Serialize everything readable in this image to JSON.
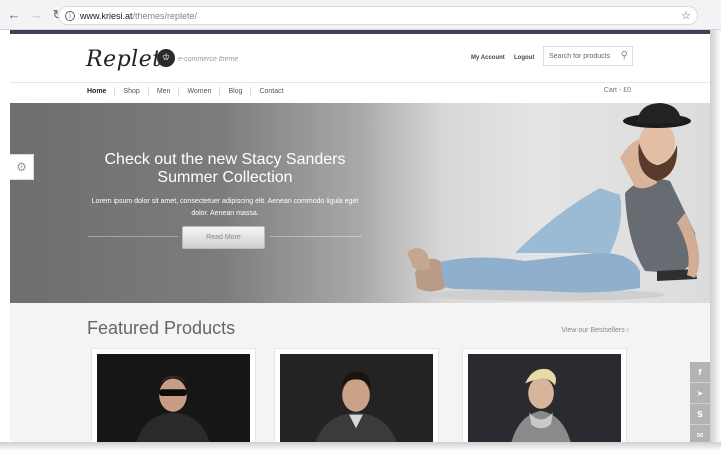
{
  "browser": {
    "url_host": "www.kriesi.at",
    "url_path": "/themes/replete/",
    "icons": [
      "back-arrow-icon",
      "forward-arrow-icon",
      "reload-icon",
      "info-icon",
      "bookmark-star-icon"
    ]
  },
  "header": {
    "logo": "Replete",
    "tagline": "e-commerce theme",
    "my_account": "My Account",
    "logout": "Logout",
    "search_placeholder": "Search for products"
  },
  "nav": {
    "items": [
      {
        "label": "Home",
        "active": true
      },
      {
        "label": "Shop",
        "active": false
      },
      {
        "label": "Men",
        "active": false
      },
      {
        "label": "Women",
        "active": false
      },
      {
        "label": "Blog",
        "active": false
      },
      {
        "label": "Contact",
        "active": false
      }
    ],
    "cart": "Cart - £0"
  },
  "hero": {
    "title_line1": "Check out the new Stacy Sanders",
    "title_line2": "Summer Collection",
    "text_line1": "Lorem ipsum dolor sit amet, consectetuer adipiscing elit. Aenean commodo ligula eget",
    "text_line2": "dolor. Aenean massa.",
    "button": "Read More"
  },
  "featured": {
    "title": "Featured Products",
    "bestsellers": "View our Bestsellers",
    "arrow": "›"
  },
  "social": {
    "buttons": [
      {
        "name": "facebook",
        "glyph": "f"
      },
      {
        "name": "share",
        "glyph": "➤"
      },
      {
        "name": "skype",
        "glyph": "S"
      },
      {
        "name": "email",
        "glyph": "✉"
      }
    ]
  },
  "colors": {
    "accent": "#4a3a5a",
    "hero_dark": "#6e6e6e",
    "hero_light": "#e4e4e4",
    "social": "#b3b3b3"
  }
}
